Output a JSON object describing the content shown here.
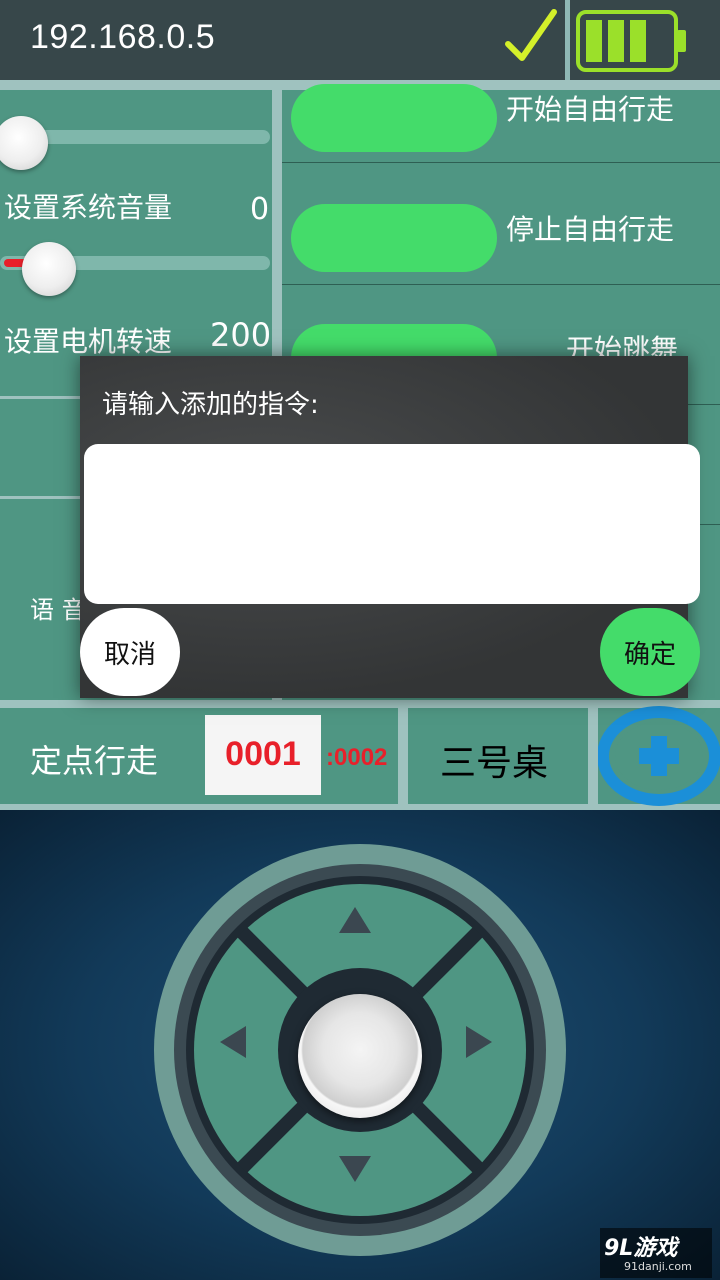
{
  "header": {
    "ip": "192.168.0.5",
    "check_icon": "checkmark-icon",
    "battery_icon": "battery-icon"
  },
  "settings": {
    "volume": {
      "label": "设置系统音量",
      "value": "0",
      "level": 0.0
    },
    "motor": {
      "label": "设置电机转速",
      "value": "200",
      "level": 0.12
    },
    "voice_label": "语 音"
  },
  "commands": {
    "items": [
      {
        "label": "开始自由行走"
      },
      {
        "label": "停止自由行走"
      },
      {
        "label": "开始跳舞"
      }
    ]
  },
  "bottom": {
    "mode_label": "定点行走",
    "point_value": "0001",
    "point_total": ":0002",
    "table_label": "三号桌",
    "add_icon": "plus-icon"
  },
  "dialog": {
    "title": "请输入添加的指令:",
    "input_value": "",
    "cancel_label": "取消",
    "ok_label": "确定"
  },
  "dpad": {
    "up": "arrow-up-icon",
    "down": "arrow-down-icon",
    "left": "arrow-left-icon",
    "right": "arrow-right-icon",
    "center": "center-button"
  },
  "watermark": {
    "brand": "9L游戏",
    "site": "91danji.com"
  },
  "colors": {
    "accent_green": "#44dc6a",
    "panel": "#4f9683",
    "divider": "#9fc2bf",
    "red": "#e8202a"
  }
}
